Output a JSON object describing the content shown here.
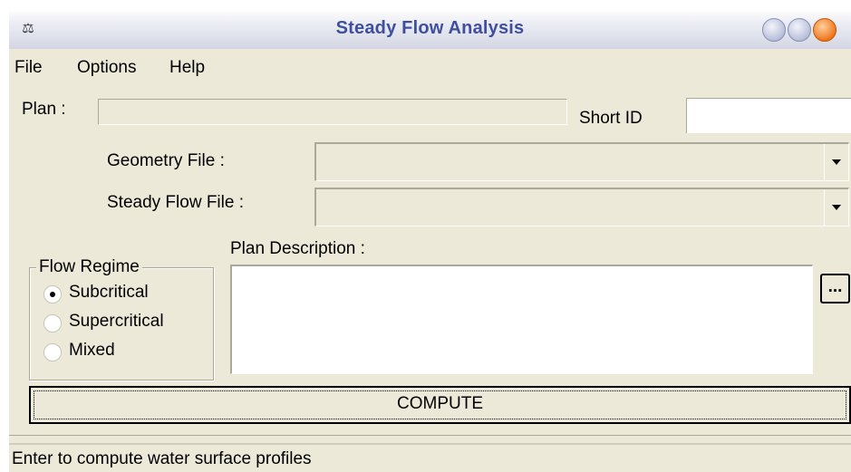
{
  "window": {
    "title": "Steady Flow Analysis"
  },
  "menu": {
    "items": [
      "File",
      "Options",
      "Help"
    ]
  },
  "plan": {
    "label": "Plan :",
    "value": ""
  },
  "short_id": {
    "label": "Short ID",
    "value": ""
  },
  "geometry_file": {
    "label": "Geometry File :",
    "value": ""
  },
  "steady_flow_file": {
    "label": "Steady Flow File :",
    "value": ""
  },
  "flow_regime": {
    "legend": "Flow Regime",
    "options": [
      "Subcritical",
      "Supercritical",
      "Mixed"
    ],
    "selected": "Subcritical"
  },
  "plan_description": {
    "label": "Plan Description :",
    "value": "",
    "browse_label": "..."
  },
  "compute_button": {
    "label": "COMPUTE"
  },
  "status_bar": {
    "text": "Enter to compute water surface profiles"
  },
  "icons": {
    "app": "app-icon",
    "dropdown": "chevron-down-icon"
  }
}
